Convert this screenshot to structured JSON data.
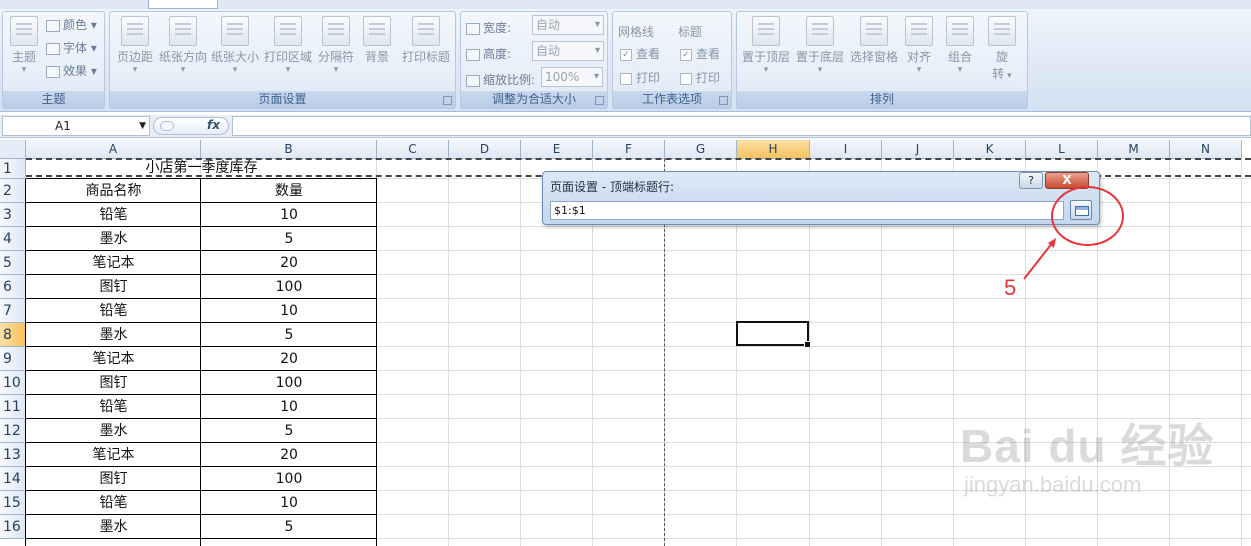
{
  "ribbon": {
    "theme_group": {
      "label": "主题",
      "theme_button": "主题",
      "colors": "颜色",
      "fonts": "字体",
      "effects": "效果"
    },
    "page_setup_group": {
      "label": "页面设置",
      "buttons": [
        "页边距",
        "纸张方向",
        "纸张大小",
        "打印区域",
        "分隔符",
        "背景",
        "打印标题"
      ]
    },
    "scale_group": {
      "label": "调整为合适大小",
      "width_label": "宽度:",
      "width_value": "自动",
      "height_label": "高度:",
      "height_value": "自动",
      "scale_label": "缩放比例:",
      "scale_value": "100%"
    },
    "sheet_options_group": {
      "label": "工作表选项",
      "gridlines": "网格线",
      "headings": "标题",
      "view": "查看",
      "print": "打印"
    },
    "arrange_group": {
      "label": "排列",
      "buttons": [
        "置于顶层",
        "置于底层",
        "选择窗格",
        "对齐",
        "组合"
      ],
      "rotate_top": "旋",
      "rotate_bottom": "转"
    }
  },
  "formula_bar": {
    "name_box": "A1",
    "fx": "fx",
    "content": ""
  },
  "columns": [
    "A",
    "B",
    "C",
    "D",
    "E",
    "F",
    "G",
    "H",
    "I",
    "J",
    "K",
    "L",
    "M",
    "N"
  ],
  "rows": [
    "1",
    "2",
    "3",
    "4",
    "5",
    "6",
    "7",
    "8",
    "9",
    "10",
    "11",
    "12",
    "13",
    "14",
    "15",
    "16"
  ],
  "sheet": {
    "title": "小店第一季度库存",
    "header": [
      "商品名称",
      "数量"
    ],
    "data": [
      [
        "铅笔",
        "10"
      ],
      [
        "墨水",
        "5"
      ],
      [
        "笔记本",
        "20"
      ],
      [
        "图钉",
        "100"
      ],
      [
        "铅笔",
        "10"
      ],
      [
        "墨水",
        "5"
      ],
      [
        "笔记本",
        "20"
      ],
      [
        "图钉",
        "100"
      ],
      [
        "铅笔",
        "10"
      ],
      [
        "墨水",
        "5"
      ],
      [
        "笔记本",
        "20"
      ],
      [
        "图钉",
        "100"
      ],
      [
        "铅笔",
        "10"
      ],
      [
        "墨水",
        "5"
      ]
    ]
  },
  "dialog": {
    "title": "页面设置 - 顶端标题行:",
    "help": "?",
    "close": "X",
    "value": "$1:$1"
  },
  "annotation": {
    "number": "5",
    "color": "#e8343b"
  },
  "watermark": {
    "brand": "Bai du 经验",
    "url": "jingyan.baidu.com"
  }
}
